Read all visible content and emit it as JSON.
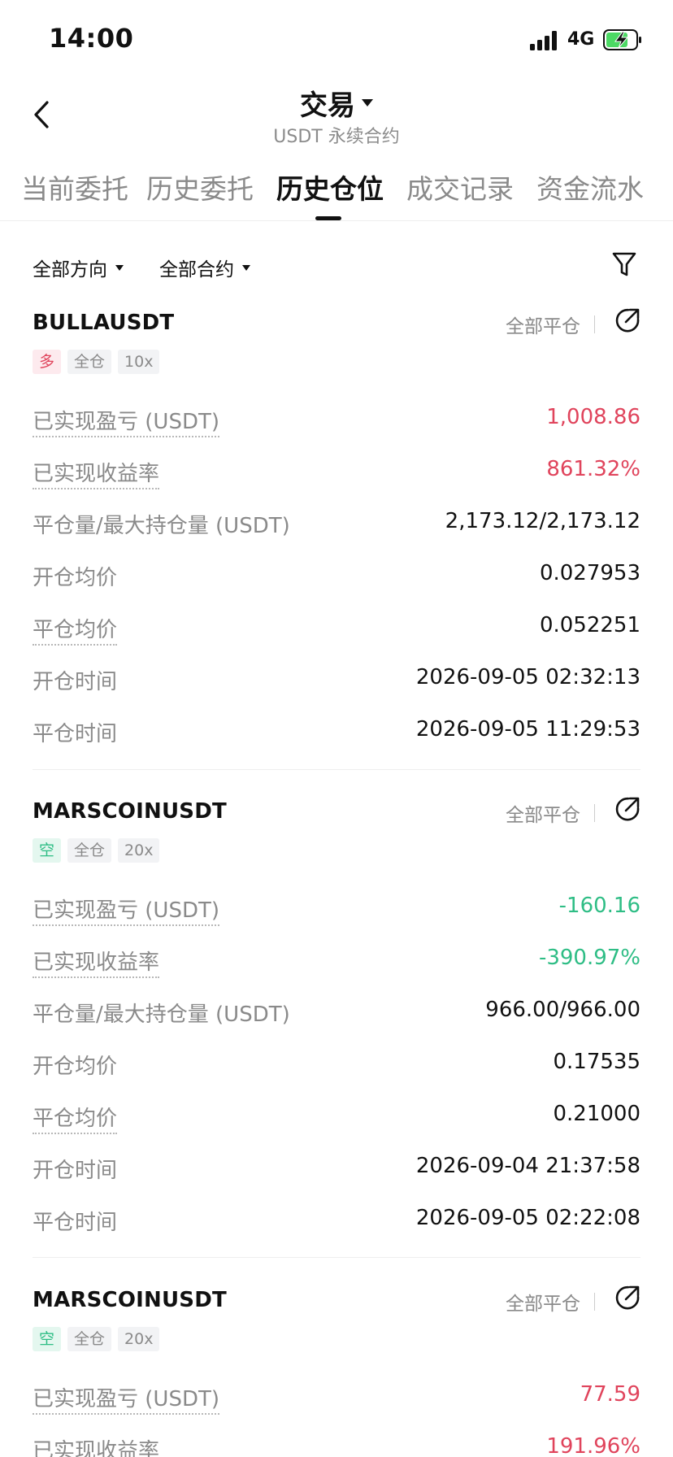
{
  "status": {
    "time": "14:00",
    "network": "4G"
  },
  "header": {
    "title": "交易",
    "subtitle": "USDT 永续合约"
  },
  "tabs": [
    {
      "label": "当前委托"
    },
    {
      "label": "历史委托"
    },
    {
      "label": "历史仓位"
    },
    {
      "label": "成交记录"
    },
    {
      "label": "资金流水"
    }
  ],
  "filters": {
    "direction": "全部方向",
    "contract": "全部合约"
  },
  "positions": [
    {
      "symbol": "BULLAUSDT",
      "close_all": "全部平仓",
      "side": "多",
      "margin": "全仓",
      "leverage": "10x",
      "rows": [
        {
          "label": "已实现盈亏 (USDT)",
          "value": "1,008.86"
        },
        {
          "label": "已实现收益率",
          "value": "861.32%"
        },
        {
          "label": "平仓量/最大持仓量 (USDT)",
          "value": "2,173.12/2,173.12"
        },
        {
          "label": "开仓均价",
          "value": "0.027953"
        },
        {
          "label": "平仓均价",
          "value": "0.052251"
        },
        {
          "label": "开仓时间",
          "value": "2026-09-05 02:32:13"
        },
        {
          "label": "平仓时间",
          "value": "2026-09-05 11:29:53"
        }
      ]
    },
    {
      "symbol": "MARSCOINUSDT",
      "close_all": "全部平仓",
      "side": "空",
      "margin": "全仓",
      "leverage": "20x",
      "rows": [
        {
          "label": "已实现盈亏 (USDT)",
          "value": "-160.16"
        },
        {
          "label": "已实现收益率",
          "value": "-390.97%"
        },
        {
          "label": "平仓量/最大持仓量 (USDT)",
          "value": "966.00/966.00"
        },
        {
          "label": "开仓均价",
          "value": "0.17535"
        },
        {
          "label": "平仓均价",
          "value": "0.21000"
        },
        {
          "label": "开仓时间",
          "value": "2026-09-04 21:37:58"
        },
        {
          "label": "平仓时间",
          "value": "2026-09-05 02:22:08"
        }
      ]
    },
    {
      "symbol": "MARSCOINUSDT",
      "close_all": "全部平仓",
      "side": "空",
      "margin": "全仓",
      "leverage": "20x",
      "rows": [
        {
          "label": "已实现盈亏 (USDT)",
          "value": "77.59"
        },
        {
          "label": "已实现收益率",
          "value": "191.96%"
        }
      ]
    }
  ],
  "colors": {
    "profit": "#e0445c",
    "loss": "#2ebd85",
    "battery": "#4cd964"
  }
}
